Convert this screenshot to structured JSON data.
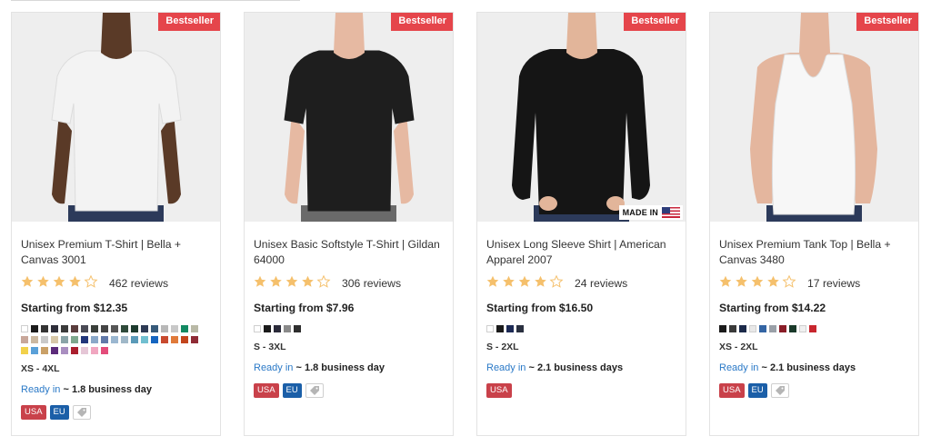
{
  "colors": {
    "badge": "#e5454b",
    "star": "#f5c06c",
    "link": "#2a79c7",
    "usa": "#c9414a",
    "eu": "#1b5fa8"
  },
  "products": [
    {
      "badge": "Bestseller",
      "title": "Unisex Premium T-Shirt | Bella + Canvas 3001",
      "rating": 4.5,
      "reviews": "462 reviews",
      "price": "Starting from $12.35",
      "shirt": "tee",
      "shirt_color": "#f3f3f3",
      "skin": "#5a3a27",
      "swatches": [
        "#ffffff",
        "#1b1b1b",
        "#333333",
        "#2e2e3a",
        "#3b3b3b",
        "#5a3d3d",
        "#4a4a55",
        "#3a3f3a",
        "#444444",
        "#565656",
        "#2f4a3a",
        "#1d3b2e",
        "#2e3b55",
        "#375a7a",
        "#b8b8b8",
        "#c8c8c8",
        "#138a63",
        "#b9b9a6",
        "#c8a79a",
        "#cbb8a0",
        "#c9c9c9",
        "#d7c7a8",
        "#8aa4a8",
        "#7ea88d",
        "#21357a",
        "#8aa8c8",
        "#6178a8",
        "#9bb7d0",
        "#a0b8c8",
        "#5a9ab8",
        "#71bfd0",
        "#1565c0",
        "#c84a2f",
        "#e07a3a",
        "#c2451d",
        "#8f2b35",
        "#f2d14a",
        "#5aa0d8",
        "#c9a067",
        "#5c2b7a",
        "#a98ec0",
        "#aa1f2e",
        "#e5c6d6",
        "#f0a6c0",
        "#e34c7a"
      ],
      "sizes": "XS - 4XL",
      "ready_prefix": "Ready in",
      "ready_days": "~ 1.8 business day",
      "tags": [
        "USA",
        "EU"
      ],
      "tag_icon": "price-tag-icon"
    },
    {
      "badge": "Bestseller",
      "title": "Unisex Basic Softstyle T-Shirt | Gildan 64000",
      "rating": 4.5,
      "reviews": "306 reviews",
      "price": "Starting from $7.96",
      "shirt": "tee",
      "shirt_color": "#1e1e1e",
      "skin": "#e6b9a2",
      "swatches": [
        "#ffffff",
        "#1b1b1b",
        "#2b2b3a",
        "#8a8a8a",
        "#2e2e2e"
      ],
      "sizes": "S - 3XL",
      "ready_prefix": "Ready in",
      "ready_days": "~ 1.8 business day",
      "tags": [
        "USA",
        "EU"
      ],
      "tag_icon": "price-tag-icon"
    },
    {
      "badge": "Bestseller",
      "title": "Unisex Long Sleeve Shirt | American Apparel 2007",
      "rating": 4.5,
      "reviews": "24 reviews",
      "price": "Starting from $16.50",
      "shirt": "long",
      "shirt_color": "#151515",
      "skin": "#e2b59a",
      "made_in": "MADE IN",
      "swatches": [
        "#ffffff",
        "#1b1b1b",
        "#1d2a55",
        "#2a3040"
      ],
      "sizes": "S - 2XL",
      "ready_prefix": "Ready in",
      "ready_days": "~ 2.1 business days",
      "tags": [
        "USA"
      ],
      "tag_icon": ""
    },
    {
      "badge": "Bestseller",
      "title": "Unisex Premium Tank Top | Bella + Canvas 3480",
      "rating": 4.0,
      "reviews": "17 reviews",
      "price": "Starting from $14.22",
      "shirt": "tank",
      "shirt_color": "#f7f7f7",
      "skin": "#e4b69e",
      "swatches": [
        "#1b1b1b",
        "#3a3a3a",
        "#1c2a4a",
        "#e8e8e8",
        "#3465a4",
        "#9aa0a8",
        "#8a1d28",
        "#1a3a2a",
        "#f0f0f0",
        "#c8262e"
      ],
      "sizes": "XS - 2XL",
      "ready_prefix": "Ready in",
      "ready_days": "~ 2.1 business days",
      "tags": [
        "USA",
        "EU"
      ],
      "tag_icon": "price-tag-icon"
    }
  ]
}
